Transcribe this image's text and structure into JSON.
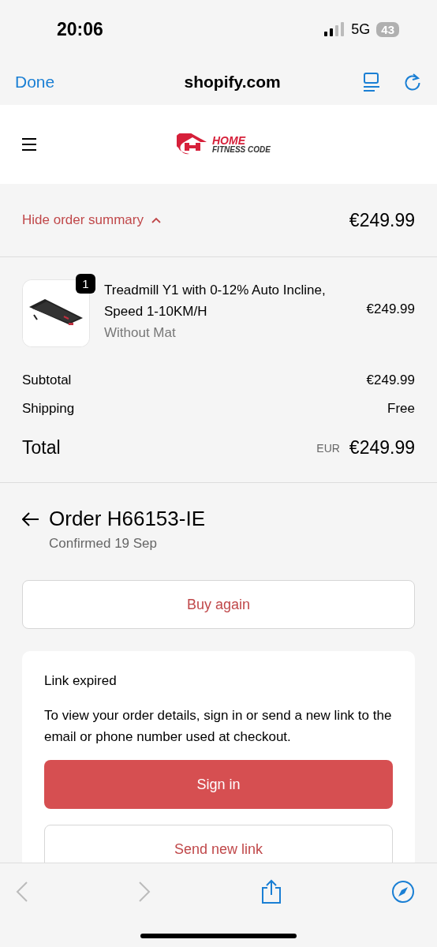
{
  "status_bar": {
    "time": "20:06",
    "network": "5G",
    "battery": "43"
  },
  "browser": {
    "done": "Done",
    "domain": "shopify.com"
  },
  "logo": {
    "line_1": "HOME",
    "line_2": "FITNESS CODE"
  },
  "summary": {
    "toggle": "Hide order summary",
    "total": "€249.99"
  },
  "items": [
    {
      "title": "Treadmill Y1 with 0-12% Auto Incline, Speed 1-10KM/H",
      "variant": "Without Mat",
      "price": "€249.99",
      "quantity": "1",
      "kind": "picture"
    }
  ],
  "totals": [
    {
      "label": "Subtotal",
      "value": "€249.99"
    },
    {
      "label": "Shipping",
      "value": "Free"
    }
  ],
  "grand_total": {
    "label": "Total",
    "currency": "EUR",
    "value": "€249.99"
  },
  "order": {
    "title": "Order H66153-IE",
    "subtitle": "Confirmed 19 Sep",
    "buy_again": "Buy again"
  },
  "notice": {
    "title": "Link expired",
    "text": "To view your order details, sign in or send a new link to the email or phone number used at checkout.",
    "primary": "Sign in",
    "secondary": "Send new link"
  },
  "toolbar": {
    "back_disabled": true,
    "forward_disabled": true
  }
}
